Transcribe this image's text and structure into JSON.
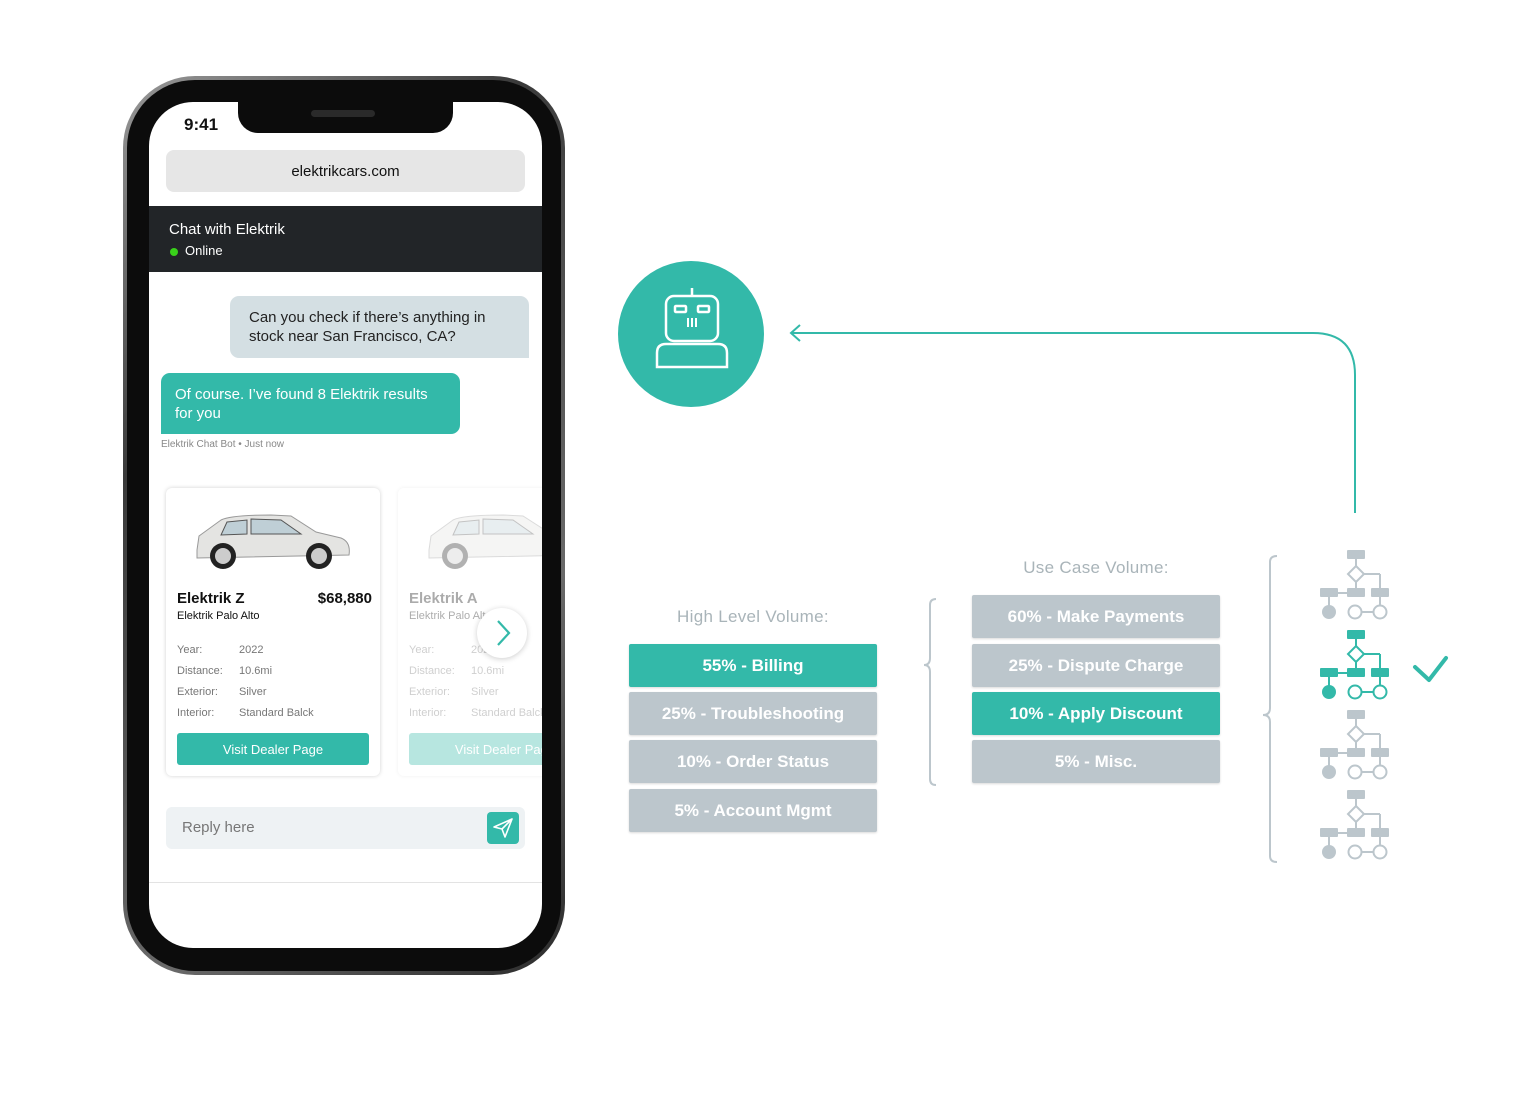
{
  "phone": {
    "time": "9:41",
    "url": "elektrikcars.com",
    "chat_title": "Chat with Elektrik",
    "status": "Online",
    "messages": [
      {
        "from": "user",
        "text": "Can you check if there’s anything in stock near San Francisco, CA?"
      },
      {
        "from": "bot",
        "text": "Of course. I’ve found 8 Elektrik results for you"
      }
    ],
    "bot_meta": "Elektrik Chat Bot • Just now",
    "cards": [
      {
        "name": "Elektrik Z",
        "price": "$68,880",
        "dealer": "Elektrik Palo Alto",
        "year_label": "Year:",
        "year": "2022",
        "distance_label": "Distance:",
        "distance": "10.6mi",
        "exterior_label": "Exterior:",
        "exterior": "Silver",
        "interior_label": "Interior:",
        "interior": "Standard Balck",
        "button": "Visit Dealer Page"
      },
      {
        "name": "Elektrik A",
        "price": "$",
        "dealer": "Elektrik Palo Alto",
        "year_label": "Year:",
        "year": "2022",
        "distance_label": "Distance:",
        "distance": "10.6mi",
        "exterior_label": "Exterior:",
        "exterior": "Silver",
        "interior_label": "Interior:",
        "interior": "Standard Balck",
        "button": "Visit Dealer Page"
      }
    ],
    "reply_placeholder": "Reply here"
  },
  "high_level": {
    "title": "High Level Volume:",
    "items": [
      {
        "label": "55% - Billing",
        "highlighted": true
      },
      {
        "label": "25% - Troubleshooting",
        "highlighted": false
      },
      {
        "label": "10% - Order Status",
        "highlighted": false
      },
      {
        "label": "5% - Account Mgmt",
        "highlighted": false
      }
    ]
  },
  "use_case": {
    "title": "Use Case Volume:",
    "items": [
      {
        "label": "60% - Make Payments",
        "highlighted": false
      },
      {
        "label": "25% - Dispute Charge",
        "highlighted": false
      },
      {
        "label": "10% - Apply Discount",
        "highlighted": true
      },
      {
        "label": "5% - Misc.",
        "highlighted": false
      }
    ]
  },
  "flows": {
    "count": 4,
    "selected_index": 1
  },
  "colors": {
    "accent": "#33b9a9",
    "muted": "#bcc6cc",
    "dark_header": "#222528"
  }
}
